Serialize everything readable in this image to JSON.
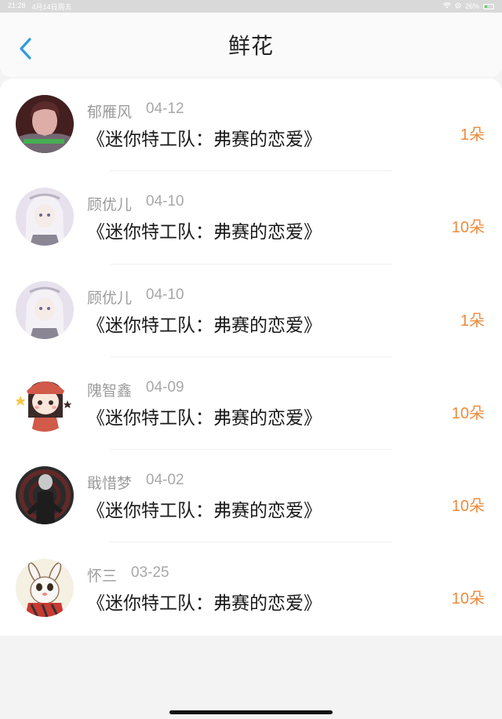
{
  "status_bar": {
    "time": "21:28",
    "date": "4月14日周五",
    "battery": "26%"
  },
  "header": {
    "title": "鲜花",
    "back_icon": "chevron-left-icon"
  },
  "colors": {
    "accent": "#2f9be0",
    "count": "#ec8b3c"
  },
  "items": [
    {
      "user": "郁雁风",
      "date": "04-12",
      "work": "《迷你特工队：弗赛的恋爱》",
      "count": "1朵"
    },
    {
      "user": "顾优儿",
      "date": "04-10",
      "work": "《迷你特工队：弗赛的恋爱》",
      "count": "10朵"
    },
    {
      "user": "顾优儿",
      "date": "04-10",
      "work": "《迷你特工队：弗赛的恋爱》",
      "count": "1朵"
    },
    {
      "user": "隗智鑫",
      "date": "04-09",
      "work": "《迷你特工队：弗赛的恋爱》",
      "count": "10朵"
    },
    {
      "user": "戢惜梦",
      "date": "04-02",
      "work": "《迷你特工队：弗赛的恋爱》",
      "count": "10朵"
    },
    {
      "user": "怀三",
      "date": "03-25",
      "work": "《迷你特工队：弗赛的恋爱》",
      "count": "10朵"
    }
  ]
}
